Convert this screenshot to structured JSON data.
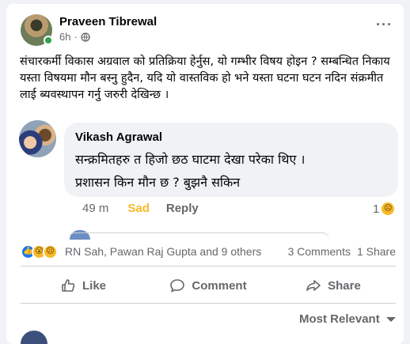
{
  "post": {
    "author": "Praveen Tibrewal",
    "time": "6h",
    "separator": "·",
    "more": "···",
    "text": "संचारकर्मी विकास अग्रवाल को प्रतिक्रिया हेर्नुस, यो गम्भीर विषय होइन ? सम्बन्धित निकाय यस्ता विषयमा मौन बस्नु हुदैन, यदि यो वास्तविक हो भने यस्ता घटना घटन नदिन संक्रमीत लाई ब्यवस्थापन गर्नु जरुरी देखिन्छ ।"
  },
  "comment": {
    "author": "Vikash Agrawal",
    "line1": "सन्क्रमितहरु त हिजो छठ घाटमा देखा परेका थिए ।",
    "line2": "प्रशासन किन मौन छ ? बुझनै सकिन",
    "time": "49 m",
    "reaction_label": "Sad",
    "reply_label": "Reply",
    "reaction_count": "1"
  },
  "stats": {
    "names": "RN Sah, Pawan Raj Gupta and 9 others",
    "comments": "3 Comments",
    "shares": "1 Share"
  },
  "actions": {
    "like": "Like",
    "comment": "Comment",
    "share": "Share"
  },
  "sort": {
    "label": "Most Relevant"
  },
  "colors": {
    "sad": "#f7b928",
    "like_blue": "#1877f2",
    "online_green": "#31a24c"
  }
}
